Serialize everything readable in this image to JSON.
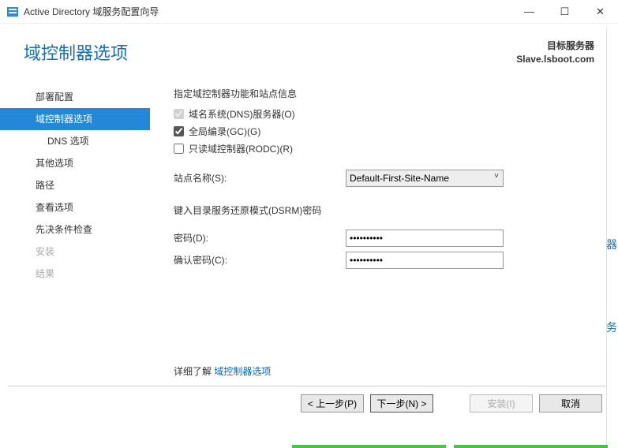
{
  "window": {
    "title": "Active Directory 域服务配置向导",
    "minimize": "—",
    "maximize": "☐",
    "close": "✕"
  },
  "header": {
    "page_title": "域控制器选项",
    "target_label": "目标服务器",
    "target_server": "Slave.lsboot.com"
  },
  "sidebar": {
    "items": [
      {
        "label": "部署配置"
      },
      {
        "label": "域控制器选项",
        "selected": true
      },
      {
        "label": "DNS 选项",
        "sub": true
      },
      {
        "label": "其他选项"
      },
      {
        "label": "路径"
      },
      {
        "label": "查看选项"
      },
      {
        "label": "先决条件检查"
      },
      {
        "label": "安装",
        "disabled": true
      },
      {
        "label": "结果",
        "disabled": true
      }
    ]
  },
  "content": {
    "intro": "指定域控制器功能和站点信息",
    "check_dns": "域名系统(DNS)服务器(O)",
    "check_gc": "全局编录(GC)(G)",
    "check_rodc": "只读域控制器(RODC)(R)",
    "site_label": "站点名称(S):",
    "site_value": "Default-First-Site-Name",
    "dsrm_intro": "键入目录服务还原模式(DSRM)密码",
    "pwd_label": "密码(D):",
    "pwd_value": "••••••••••",
    "pwd2_label": "确认密码(C):",
    "pwd2_value": "••••••••••",
    "learn_more_prefix": "详细了解 ",
    "learn_more_link": "域控制器选项"
  },
  "footer": {
    "prev": "< 上一步(P)",
    "next": "下一步(N) >",
    "install": "安装(I)",
    "cancel": "取消"
  },
  "stray": {
    "a": "器",
    "b": "务"
  }
}
